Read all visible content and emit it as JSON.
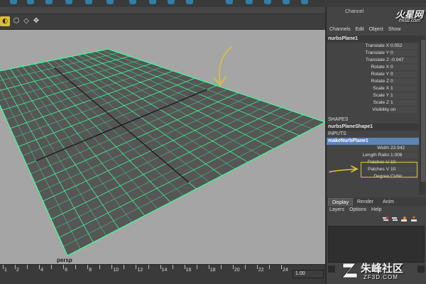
{
  "channel_box": {
    "title": "Channel",
    "menu": [
      "Channels",
      "Edit",
      "Object",
      "Show"
    ],
    "transform_node": "nurbsPlane1",
    "attributes": [
      {
        "label": "Translate X",
        "value": "0.052"
      },
      {
        "label": "Translate Y",
        "value": "0"
      },
      {
        "label": "Translate Z",
        "value": "-0.047"
      },
      {
        "label": "Rotate X",
        "value": "0"
      },
      {
        "label": "Rotate Y",
        "value": "0"
      },
      {
        "label": "Rotate Z",
        "value": "0"
      },
      {
        "label": "Scale X",
        "value": "1"
      },
      {
        "label": "Scale Y",
        "value": "1"
      },
      {
        "label": "Scale Z",
        "value": "1"
      },
      {
        "label": "Visibility",
        "value": "on"
      }
    ],
    "shapes_header": "SHAPES",
    "shape_node": "nurbsPlaneShape1",
    "inputs_header": "INPUTS",
    "input_node": "makeNurbPlane1",
    "input_attributes": [
      {
        "label": "Width",
        "value": "23.942"
      },
      {
        "label": "Length Ratio",
        "value": "1.006"
      },
      {
        "label": "Patches U",
        "value": "10"
      },
      {
        "label": "Patches V",
        "value": "10"
      },
      {
        "label": "Degree",
        "value": "Cubic"
      }
    ]
  },
  "layer_editor": {
    "tabs": [
      "Display",
      "Render",
      "Anim"
    ],
    "menu": [
      "Layers",
      "Options",
      "Help"
    ]
  },
  "viewport": {
    "camera_label": "persp"
  },
  "timeline": {
    "ticks": [
      "1",
      "2",
      "4",
      "6",
      "8",
      "10",
      "12",
      "14",
      "16",
      "18",
      "20",
      "22",
      "24"
    ],
    "current_frame": "1.00"
  },
  "watermarks": {
    "top_logo": "火星网",
    "top_url": "hxsd.com",
    "bottom_logo": "朱峰社区",
    "bottom_url": "ZF3D.COM"
  },
  "colors": {
    "grid_line": "#3dff9a",
    "plane_fill": "#565656",
    "viewport_bg": "#a5a5a5",
    "arrow": "#d9c43a",
    "selected_node": "#5a86b4"
  }
}
